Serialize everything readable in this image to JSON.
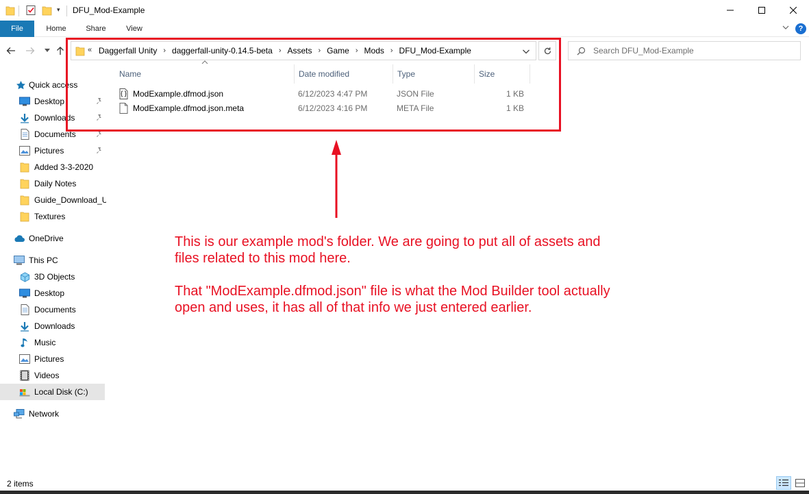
{
  "window": {
    "title": "DFU_Mod-Example",
    "minimize_icon": "minimize-icon",
    "maximize_icon": "maximize-icon",
    "close_icon": "close-icon"
  },
  "ribbon": {
    "tabs": [
      {
        "label": "File",
        "active": true
      },
      {
        "label": "Home"
      },
      {
        "label": "Share"
      },
      {
        "label": "View"
      }
    ],
    "accent": "#1a79b5",
    "help_label": "?"
  },
  "address": {
    "overflow": "«",
    "separator": "›",
    "crumbs": [
      "Daggerfall Unity",
      "daggerfall-unity-0.14.5-beta",
      "Assets",
      "Game",
      "Mods",
      "DFU_Mod-Example"
    ]
  },
  "search": {
    "placeholder": "Search DFU_Mod-Example"
  },
  "sidebar": {
    "items": [
      {
        "label": "Quick access",
        "icon": "star-icon"
      },
      {
        "label": "Desktop",
        "icon": "desktop-icon",
        "pinned": true
      },
      {
        "label": "Downloads",
        "icon": "download-icon",
        "pinned": true
      },
      {
        "label": "Documents",
        "icon": "document-icon",
        "pinned": true
      },
      {
        "label": "Pictures",
        "icon": "pictures-icon",
        "pinned": true
      },
      {
        "label": "Added 3-3-2020",
        "icon": "folder-icon"
      },
      {
        "label": "Daily Notes",
        "icon": "folder-icon"
      },
      {
        "label": "Guide_Download_U",
        "icon": "folder-icon"
      },
      {
        "label": "Textures",
        "icon": "folder-icon"
      },
      {
        "label": "OneDrive",
        "icon": "cloud-icon"
      },
      {
        "label": "This PC",
        "icon": "computer-icon"
      },
      {
        "label": "3D Objects",
        "icon": "cube-icon"
      },
      {
        "label": "Desktop",
        "icon": "desktop-icon"
      },
      {
        "label": "Documents",
        "icon": "document-icon"
      },
      {
        "label": "Downloads",
        "icon": "download-icon"
      },
      {
        "label": "Music",
        "icon": "music-icon"
      },
      {
        "label": "Pictures",
        "icon": "pictures-icon"
      },
      {
        "label": "Videos",
        "icon": "video-icon"
      },
      {
        "label": "Local Disk (C:)",
        "icon": "drive-icon",
        "selected": true
      },
      {
        "label": "Network",
        "icon": "network-icon"
      }
    ]
  },
  "columns": {
    "name": "Name",
    "date": "Date modified",
    "type": "Type",
    "size": "Size"
  },
  "files": [
    {
      "name": "ModExample.dfmod.json",
      "date": "6/12/2023 4:47 PM",
      "type": "JSON File",
      "size": "1 KB",
      "icon": "json-file-icon"
    },
    {
      "name": "ModExample.dfmod.json.meta",
      "date": "6/12/2023 4:16 PM",
      "type": "META File",
      "size": "1 KB",
      "icon": "file-icon"
    }
  ],
  "annotation": {
    "color": "#e81123",
    "line1": "This is our example mod's folder. We are going to put all of assets and",
    "line2": "files related to this mod here.",
    "line3": "That \"ModExample.dfmod.json\" file is what the Mod Builder tool actually",
    "line4": "open and uses, it has all of that info we just entered earlier."
  },
  "status": {
    "item_count": "2 items"
  }
}
